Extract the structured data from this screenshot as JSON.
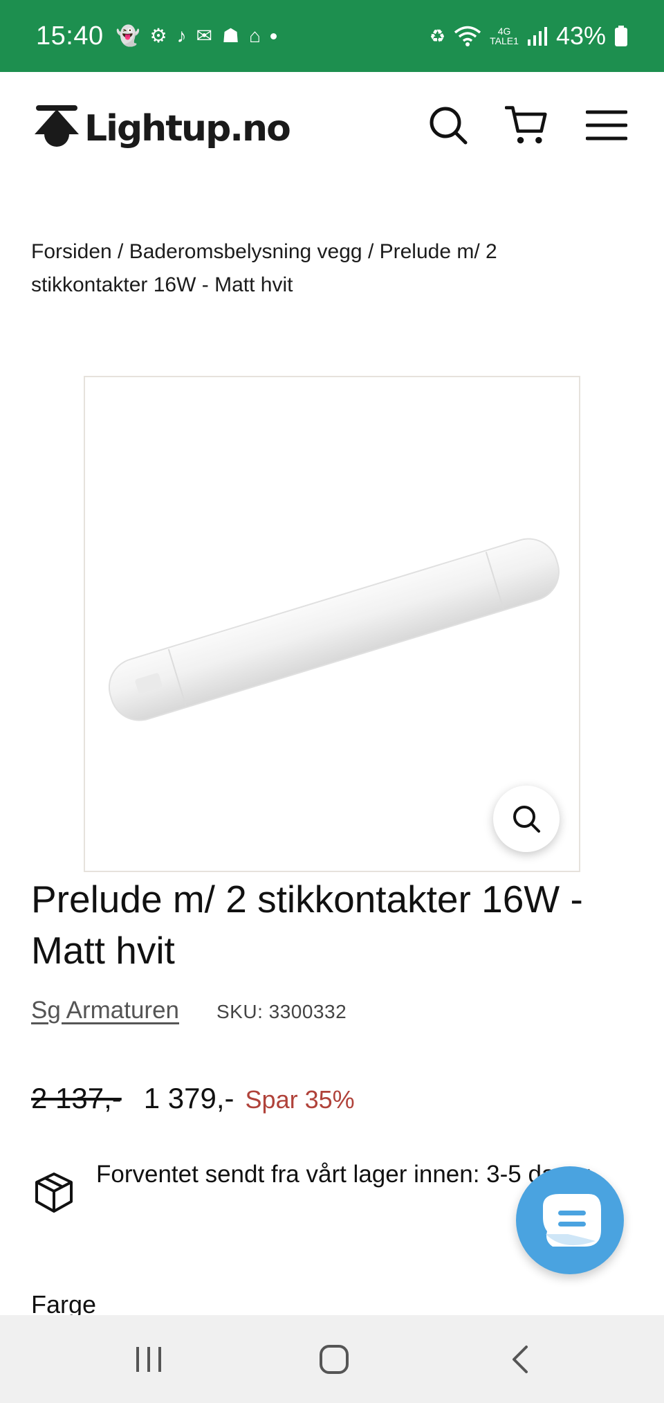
{
  "status_bar": {
    "time": "15:40",
    "network_top": "4G",
    "network_bottom": "TALE1",
    "battery_percent": "43%"
  },
  "header": {
    "logo_text": "Lightup.no",
    "icons": [
      "search-icon",
      "cart-icon",
      "menu-icon"
    ]
  },
  "breadcrumb": {
    "items": [
      "Forsiden",
      "Baderomsbelysning vegg",
      "Prelude m/ 2 stikkontakter 16W - Matt hvit"
    ],
    "separator": " / "
  },
  "product": {
    "title": "Prelude m/ 2 stikkontakter 16W - Matt hvit",
    "vendor": "Sg Armaturen",
    "sku": "SKU: 3300332",
    "price_old": "2 137,-",
    "price_new": "1 379,-",
    "savings": "Spar 35%",
    "shipping": "Forventet sendt fra vårt lager innen: 3-5 dager",
    "color_label": "Farge"
  },
  "colors": {
    "status_bar": "#1d8f4f",
    "savings": "#b0423a",
    "chat_button": "#4aa3e0"
  }
}
